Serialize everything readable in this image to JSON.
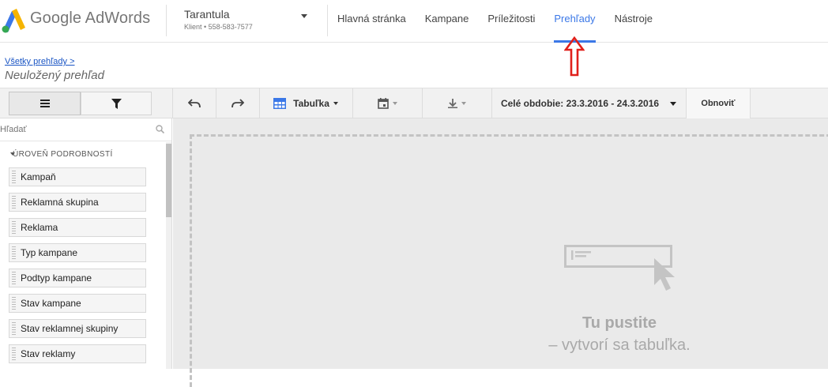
{
  "app": {
    "logo_text": "Google AdWords"
  },
  "account": {
    "name": "Tarantula",
    "meta": "Klient  •  558-583-7577"
  },
  "nav": [
    {
      "label": "Hlavná stránka",
      "active": false
    },
    {
      "label": "Kampane",
      "active": false
    },
    {
      "label": "Príležitosti",
      "active": false
    },
    {
      "label": "Prehľady",
      "active": true
    },
    {
      "label": "Nástroje",
      "active": false
    }
  ],
  "breadcrumb": {
    "link": "Všetky prehľady >",
    "title": "Neuložený prehľad"
  },
  "toolbar": {
    "table_label": "Tabuľka",
    "date_range": "Celé obdobie: 23.3.2016 - 24.3.2016",
    "refresh_label": "Obnoviť"
  },
  "sidebar": {
    "search_placeholder": "Hľadať",
    "section_title": "ÚROVEŇ PODROBNOSTÍ",
    "fields": [
      "Kampaň",
      "Reklamná skupina",
      "Reklama",
      "Typ kampane",
      "Podtyp kampane",
      "Stav kampane",
      "Stav reklamnej skupiny",
      "Stav reklamy"
    ]
  },
  "dropzone": {
    "title": "Tu pustite",
    "subtitle": "– vytvorí sa tabuľka."
  },
  "colors": {
    "accent": "#3b78e7",
    "annotation_arrow": "#e0201b"
  }
}
